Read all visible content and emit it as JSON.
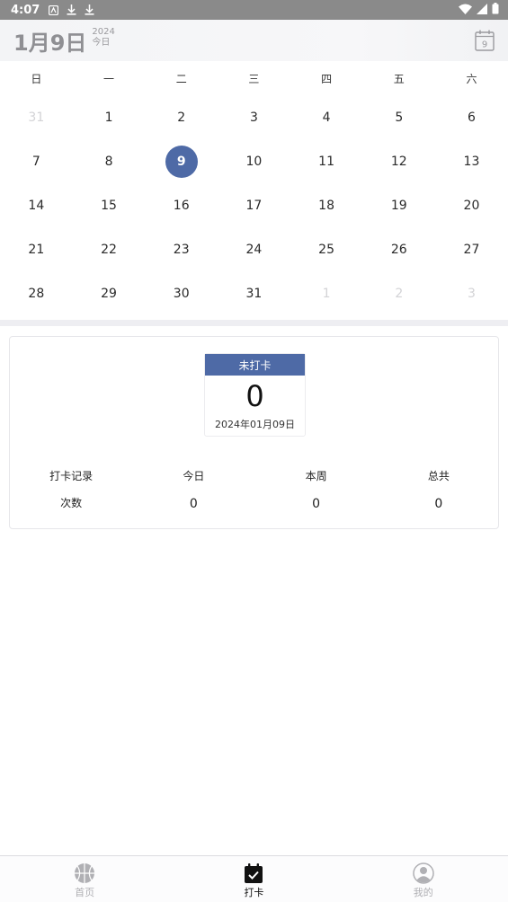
{
  "status_bar": {
    "time": "4:07"
  },
  "header": {
    "date": "1月9日",
    "year": "2024",
    "today": "今日",
    "calendar_day": "9"
  },
  "weekdays": [
    "日",
    "一",
    "二",
    "三",
    "四",
    "五",
    "六"
  ],
  "calendar": {
    "selected": "9",
    "rows": [
      [
        {
          "d": "31",
          "o": true
        },
        {
          "d": "1"
        },
        {
          "d": "2"
        },
        {
          "d": "3"
        },
        {
          "d": "4"
        },
        {
          "d": "5"
        },
        {
          "d": "6"
        }
      ],
      [
        {
          "d": "7"
        },
        {
          "d": "8"
        },
        {
          "d": "9",
          "s": true
        },
        {
          "d": "10"
        },
        {
          "d": "11"
        },
        {
          "d": "12"
        },
        {
          "d": "13"
        }
      ],
      [
        {
          "d": "14"
        },
        {
          "d": "15"
        },
        {
          "d": "16"
        },
        {
          "d": "17"
        },
        {
          "d": "18"
        },
        {
          "d": "19"
        },
        {
          "d": "20"
        }
      ],
      [
        {
          "d": "21"
        },
        {
          "d": "22"
        },
        {
          "d": "23"
        },
        {
          "d": "24"
        },
        {
          "d": "25"
        },
        {
          "d": "26"
        },
        {
          "d": "27"
        }
      ],
      [
        {
          "d": "28"
        },
        {
          "d": "29"
        },
        {
          "d": "30"
        },
        {
          "d": "31"
        },
        {
          "d": "1",
          "o": true
        },
        {
          "d": "2",
          "o": true
        },
        {
          "d": "3",
          "o": true
        }
      ]
    ]
  },
  "punch": {
    "status": "未打卡",
    "count": "0",
    "date": "2024年01月09日"
  },
  "stats": {
    "headers": [
      "打卡记录",
      "今日",
      "本周",
      "总共"
    ],
    "row_label": "次数",
    "values": [
      "0",
      "0",
      "0"
    ]
  },
  "nav": {
    "tabs": [
      {
        "label": "首页",
        "icon": "basketball-icon"
      },
      {
        "label": "打卡",
        "icon": "calendar-check-icon",
        "active": true
      },
      {
        "label": "我的",
        "icon": "user-icon"
      }
    ]
  },
  "colors": {
    "accent": "#4e6aa6",
    "status_bar": "#8a8a8a"
  }
}
